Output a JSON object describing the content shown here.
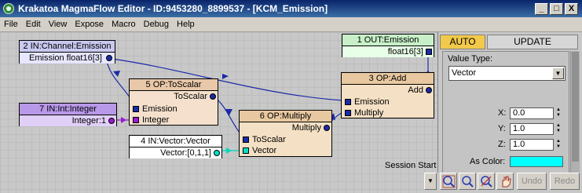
{
  "window": {
    "title": "Krakatoa MagmaFlow Editor - ID:9453280_8899537 - [KCM_Emission]",
    "buttons": {
      "minimize": "_",
      "maximize": "□",
      "close": "X"
    }
  },
  "menu": [
    "File",
    "Edit",
    "View",
    "Expose",
    "Macro",
    "Debug",
    "Help"
  ],
  "nodes": {
    "out_emission": {
      "title": "1 OUT:Emission",
      "port": "float16[3]",
      "color": "#c8f0c8"
    },
    "in_channel": {
      "title": "2 IN:Channel:Emission",
      "port": "Emission float16[3]",
      "color": "#c8c8f0"
    },
    "to_scalar": {
      "title": "5 OP:ToScalar",
      "out": "ToScalar",
      "in1": "Emission",
      "in2": "Integer",
      "color": "#f4e0cc"
    },
    "add": {
      "title": "3 OP:Add",
      "out": "Add",
      "in1": "Emission",
      "in2": "Multiply",
      "color": "#f4e0c4"
    },
    "in_integer": {
      "title": "7 IN:Int:Integer",
      "port": "Integer:1",
      "color": "#d0b8f0"
    },
    "multiply": {
      "title": "6 OP:Multiply",
      "out": "Multiply",
      "in1": "ToScalar",
      "in2": "Vector",
      "color": "#f4e0c4"
    },
    "in_vector": {
      "title": "4 IN:Vector:Vector",
      "port": "Vector:[0,1,1]",
      "color": "#ffffff"
    }
  },
  "panel": {
    "tab_auto": "AUTO",
    "tab_update": "UPDATE",
    "value_type_label": "Value Type:",
    "value_type_selected": "Vector",
    "x_label": "X:",
    "x_value": "0.0",
    "y_label": "Y:",
    "y_value": "1.0",
    "z_label": "Z:",
    "z_value": "1.0",
    "color_label": "As Color:",
    "color_value": "#00ffff"
  },
  "bottom": {
    "session_label": "Session Start",
    "undo": "Undo",
    "redo": "Redo",
    "icons": [
      "zoom-extents-icon",
      "zoom-icon",
      "zoom-region-icon",
      "pan-icon"
    ]
  },
  "colors": {
    "socket": "#1a2aa8",
    "wire": "#1a2aa8",
    "wire_integer": "#9a1ad0",
    "wire_vector": "#00d8c0",
    "tab_auto": "#f2c94a"
  }
}
